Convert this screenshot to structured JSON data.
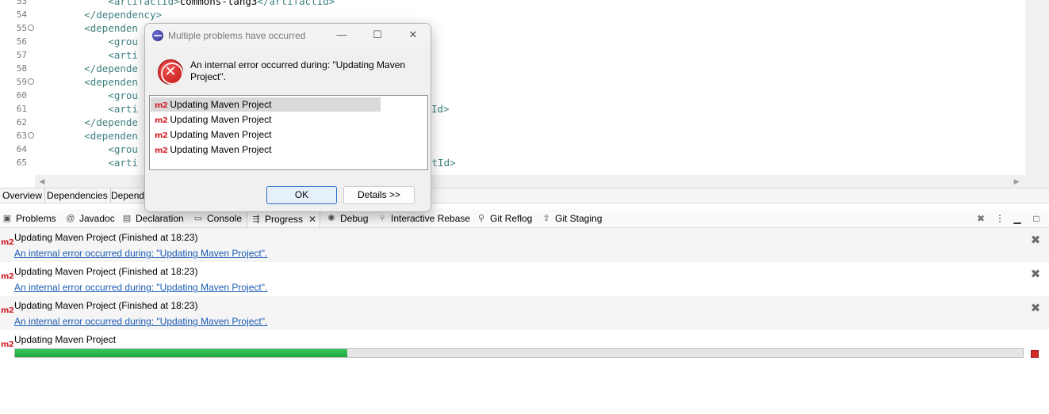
{
  "editor": {
    "lines": [
      {
        "num": "53",
        "fold": "",
        "indent": "            ",
        "open": "<artifactId>",
        "text": "commons-lang3",
        "close": "</artifactId>"
      },
      {
        "num": "54",
        "fold": "",
        "indent": "        ",
        "open": "</dependency>",
        "text": "",
        "close": ""
      },
      {
        "num": "55",
        "fold": "⊖",
        "indent": "        ",
        "open": "<dependen",
        "text": "",
        "close": ""
      },
      {
        "num": "56",
        "fold": "",
        "indent": "            ",
        "open": "<grou",
        "text": "",
        "close": ""
      },
      {
        "num": "57",
        "fold": "",
        "indent": "            ",
        "open": "<arti",
        "text": "",
        "close": ""
      },
      {
        "num": "58",
        "fold": "",
        "indent": "        ",
        "open": "</depende",
        "text": "",
        "close": ""
      },
      {
        "num": "59",
        "fold": "⊖",
        "indent": "        ",
        "open": "<dependen",
        "text": "",
        "close": ""
      },
      {
        "num": "60",
        "fold": "",
        "indent": "            ",
        "open": "<grou",
        "text": "",
        "close": ""
      },
      {
        "num": "61",
        "fold": "",
        "indent": "            ",
        "open": "<arti",
        "text": "",
        "close": "Id>"
      },
      {
        "num": "62",
        "fold": "",
        "indent": "        ",
        "open": "</depende",
        "text": "",
        "close": ""
      },
      {
        "num": "63",
        "fold": "⊖",
        "indent": "        ",
        "open": "<dependen",
        "text": "",
        "close": ""
      },
      {
        "num": "64",
        "fold": "",
        "indent": "            ",
        "open": "<grou",
        "text": "",
        "close": ""
      },
      {
        "num": "65",
        "fold": "",
        "indent": "            ",
        "open": "<arti",
        "text": "",
        "close": "ctId>"
      }
    ],
    "scroll_left_arrow": "◀",
    "scroll_right_arrow": "▶"
  },
  "editor_tabs": [
    "Overview",
    "Dependencies",
    "Depend"
  ],
  "view_tabs": [
    {
      "label": "Problems",
      "icon": "problems-icon",
      "glyph": "▣"
    },
    {
      "label": "Javadoc",
      "icon": "javadoc-icon",
      "glyph": "@"
    },
    {
      "label": "Declaration",
      "icon": "declaration-icon",
      "glyph": "▤"
    },
    {
      "label": "Console",
      "icon": "console-icon",
      "glyph": "▭"
    },
    {
      "label": "Progress",
      "icon": "progress-icon",
      "glyph": "⇶",
      "active": true,
      "close": "✕"
    },
    {
      "label": "Debug",
      "icon": "debug-icon",
      "glyph": "✺"
    },
    {
      "label": "Interactive Rebase",
      "icon": "rebase-icon",
      "glyph": "⑂"
    },
    {
      "label": "Git Reflog",
      "icon": "reflog-icon",
      "glyph": "⚲"
    },
    {
      "label": "Git Staging",
      "icon": "staging-icon",
      "glyph": "⇪"
    }
  ],
  "view_toolbar": {
    "remove_all": "✖",
    "menu": "⋮",
    "minimize": "▁",
    "maximize": "□"
  },
  "progress": {
    "badge": "m2",
    "remove_glyph": "✖",
    "finished": [
      {
        "title": "Updating Maven Project (Finished at 18:23)",
        "link": "An internal error occurred during: \"Updating Maven Project\"."
      },
      {
        "title": "Updating Maven Project (Finished at 18:23)",
        "link": "An internal error occurred during: \"Updating Maven Project\"."
      },
      {
        "title": "Updating Maven Project (Finished at 18:23)",
        "link": "An internal error occurred during: \"Updating Maven Project\"."
      }
    ],
    "running": {
      "title": "Updating Maven Project",
      "percent": 33
    }
  },
  "dialog": {
    "title": "Multiple problems have occurred",
    "minimize": "—",
    "maximize": "☐",
    "close": "✕",
    "error_glyph": "✕",
    "message": "An internal error occurred during: \"Updating Maven Project\".",
    "items": [
      "Updating Maven Project",
      "Updating Maven Project",
      "Updating Maven Project",
      "Updating Maven Project"
    ],
    "item_badge": "m2",
    "ok_label": "OK",
    "details_label": "Details >>"
  },
  "colors": {
    "error_red": "#d4232a",
    "link_blue": "#1a5bb5",
    "progress_green": "#1fa53c",
    "tag_teal": "#3f7f7f"
  }
}
